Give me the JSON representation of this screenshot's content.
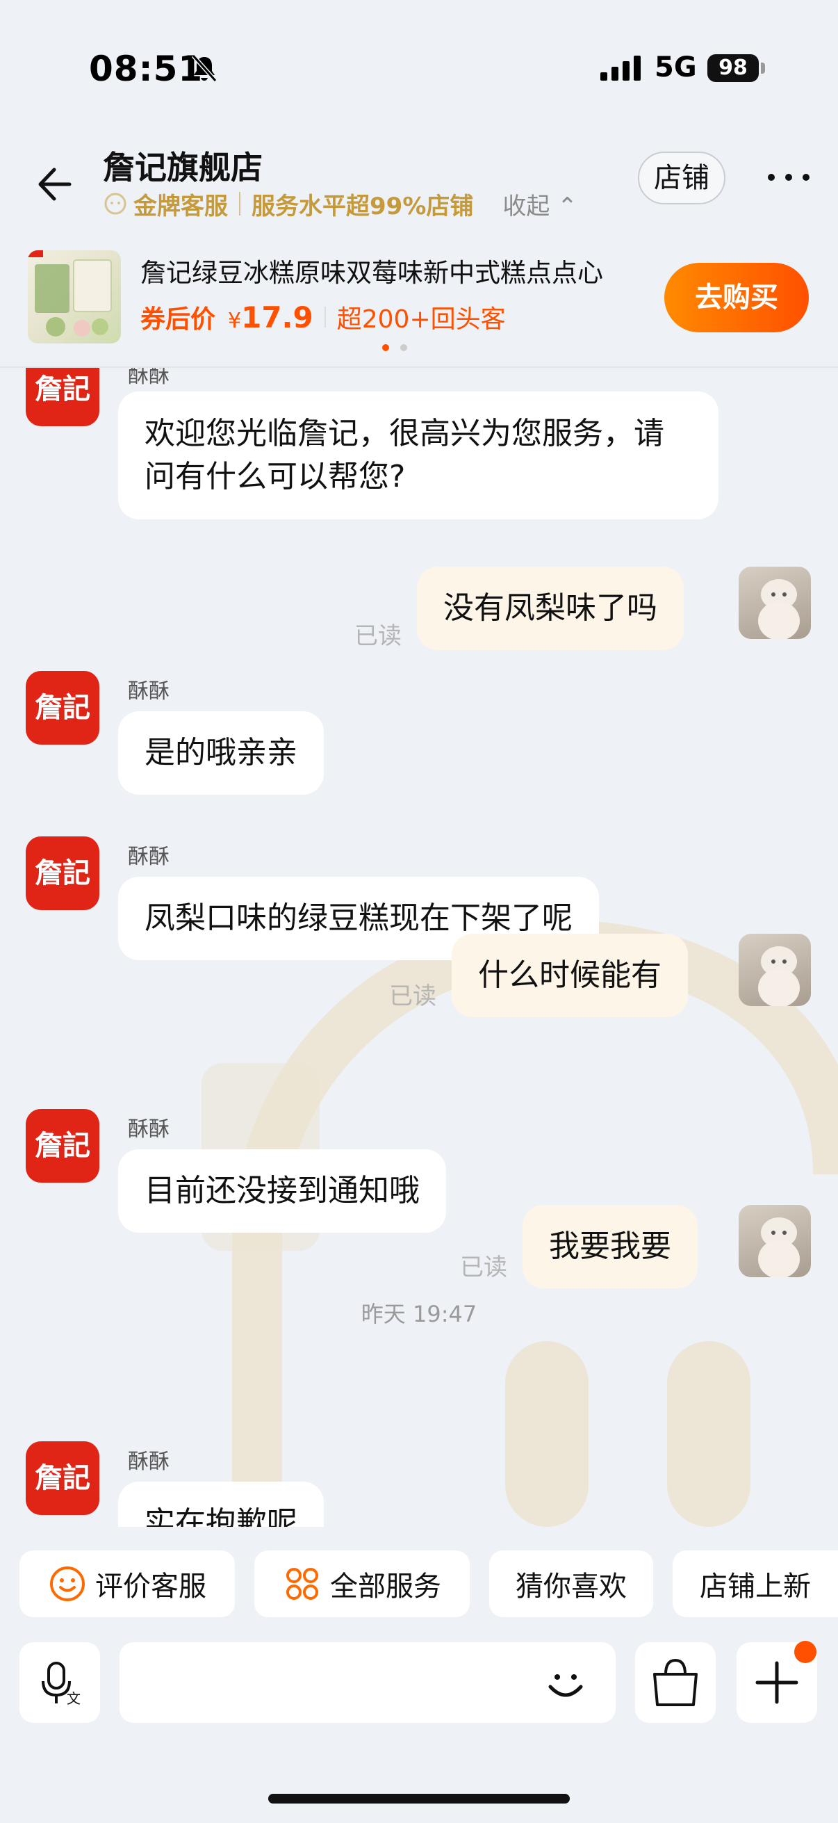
{
  "status_bar": {
    "time": "08:51",
    "network": "5G",
    "battery": "98"
  },
  "header": {
    "shop_name": "詹记旗舰店",
    "service_badge": "金牌客服",
    "service_level": "服务水平超99%店铺",
    "collapse_label": "收起",
    "store_button": "店铺"
  },
  "product": {
    "name": "詹记绿豆冰糕原味双莓味新中式糕点点心",
    "coupon_label": "券后价",
    "currency": "¥",
    "price": "17.9",
    "returning": "超200+回头客",
    "buy_label": "去购买"
  },
  "chat": {
    "shop_avatar_text": "詹記",
    "read_label": "已读",
    "cutoff_sender": "酥酥",
    "messages": [
      {
        "side": "left",
        "sender": "",
        "text": "欢迎您光临詹记，很高兴为您服务，请问有什么可以帮您?"
      },
      {
        "side": "right",
        "text": "没有凤梨味了吗",
        "read": "已读"
      },
      {
        "side": "left",
        "sender": "酥酥",
        "text": "是的哦亲亲"
      },
      {
        "side": "left",
        "sender": "酥酥",
        "text": "凤梨口味的绿豆糕现在下架了呢"
      },
      {
        "side": "right",
        "text": "什么时候能有",
        "read": "已读"
      },
      {
        "side": "left",
        "sender": "酥酥",
        "text": "目前还没接到通知哦"
      },
      {
        "side": "right",
        "text": "我要我要",
        "read": "已读"
      },
      {
        "type": "time",
        "text": "昨天 19:47"
      },
      {
        "side": "left",
        "sender": "酥酥",
        "text": "实在抱歉呢"
      }
    ]
  },
  "quick_actions": [
    {
      "label": "评价客服",
      "icon": "smile-icon"
    },
    {
      "label": "全部服务",
      "icon": "grid-icon"
    },
    {
      "label": "猜你喜欢",
      "icon": ""
    },
    {
      "label": "店铺上新",
      "icon": ""
    }
  ],
  "input_bar": {
    "placeholder": ""
  },
  "colors": {
    "accent": "#ff5000",
    "gold": "#c49a3a",
    "shop_red": "#e02416",
    "user_bubble": "#fdf5e8"
  }
}
